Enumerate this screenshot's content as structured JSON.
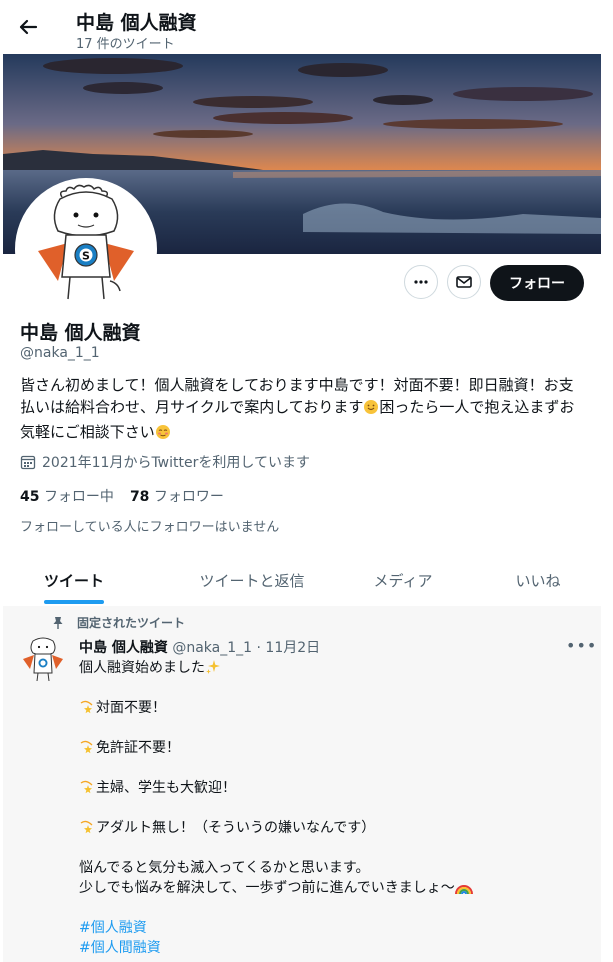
{
  "header": {
    "title": "中島 個人融資",
    "tweet_count": "17 件のツイート"
  },
  "profile": {
    "name": "中島 個人融資",
    "handle": "@naka_1_1",
    "follow_label": "フォロー",
    "bio_1": "皆さん初めまして！個人融資をしております中島です！対面不要！即日融資！お支",
    "bio_2": "払いは給料合わせ、月サイクルで案内しております",
    "bio_3": "困ったら一人で抱え込まずお",
    "bio_4": "気軽にご相談下さい",
    "joined": "2021年11月からTwitterを利用しています",
    "following_count": "45",
    "following_label": "フォロー中",
    "followers_count": "78",
    "followers_label": "フォロワー",
    "followers_note": "フォローしている人にフォロワーはいません"
  },
  "tabs": [
    "ツイート",
    "ツイートと返信",
    "メディア",
    "いいね"
  ],
  "pinned_tweet": {
    "pinned_label": "固定されたツイート",
    "name": "中島 個人融資",
    "handle": "@naka_1_1",
    "dot": "·",
    "date": "11月2日",
    "line_1": "個人融資始めました",
    "line_2": "対面不要！",
    "line_3": "免許証不要！",
    "line_4": "主婦、学生も大歓迎！",
    "line_5": "アダルト無し！（そういうの嫌いなんです）",
    "line_6": "悩んでると気分も滅入ってくるかと思います。",
    "line_7": "少しでも悩みを解決して、一歩ずつ前に進んでいきましょ〜",
    "hashtag_1": "#個人融資",
    "hashtag_2": "#個人間融資"
  },
  "colors": {
    "accent": "#1d9bf0",
    "text": "#0f1419",
    "muted": "#536471"
  },
  "icons": [
    "back-arrow-icon",
    "more-icon",
    "mail-icon",
    "calendar-icon",
    "pin-icon",
    "sparkles-icon",
    "dizzy-star-icon",
    "rainbow-icon",
    "smile-icon",
    "blush-icon"
  ]
}
